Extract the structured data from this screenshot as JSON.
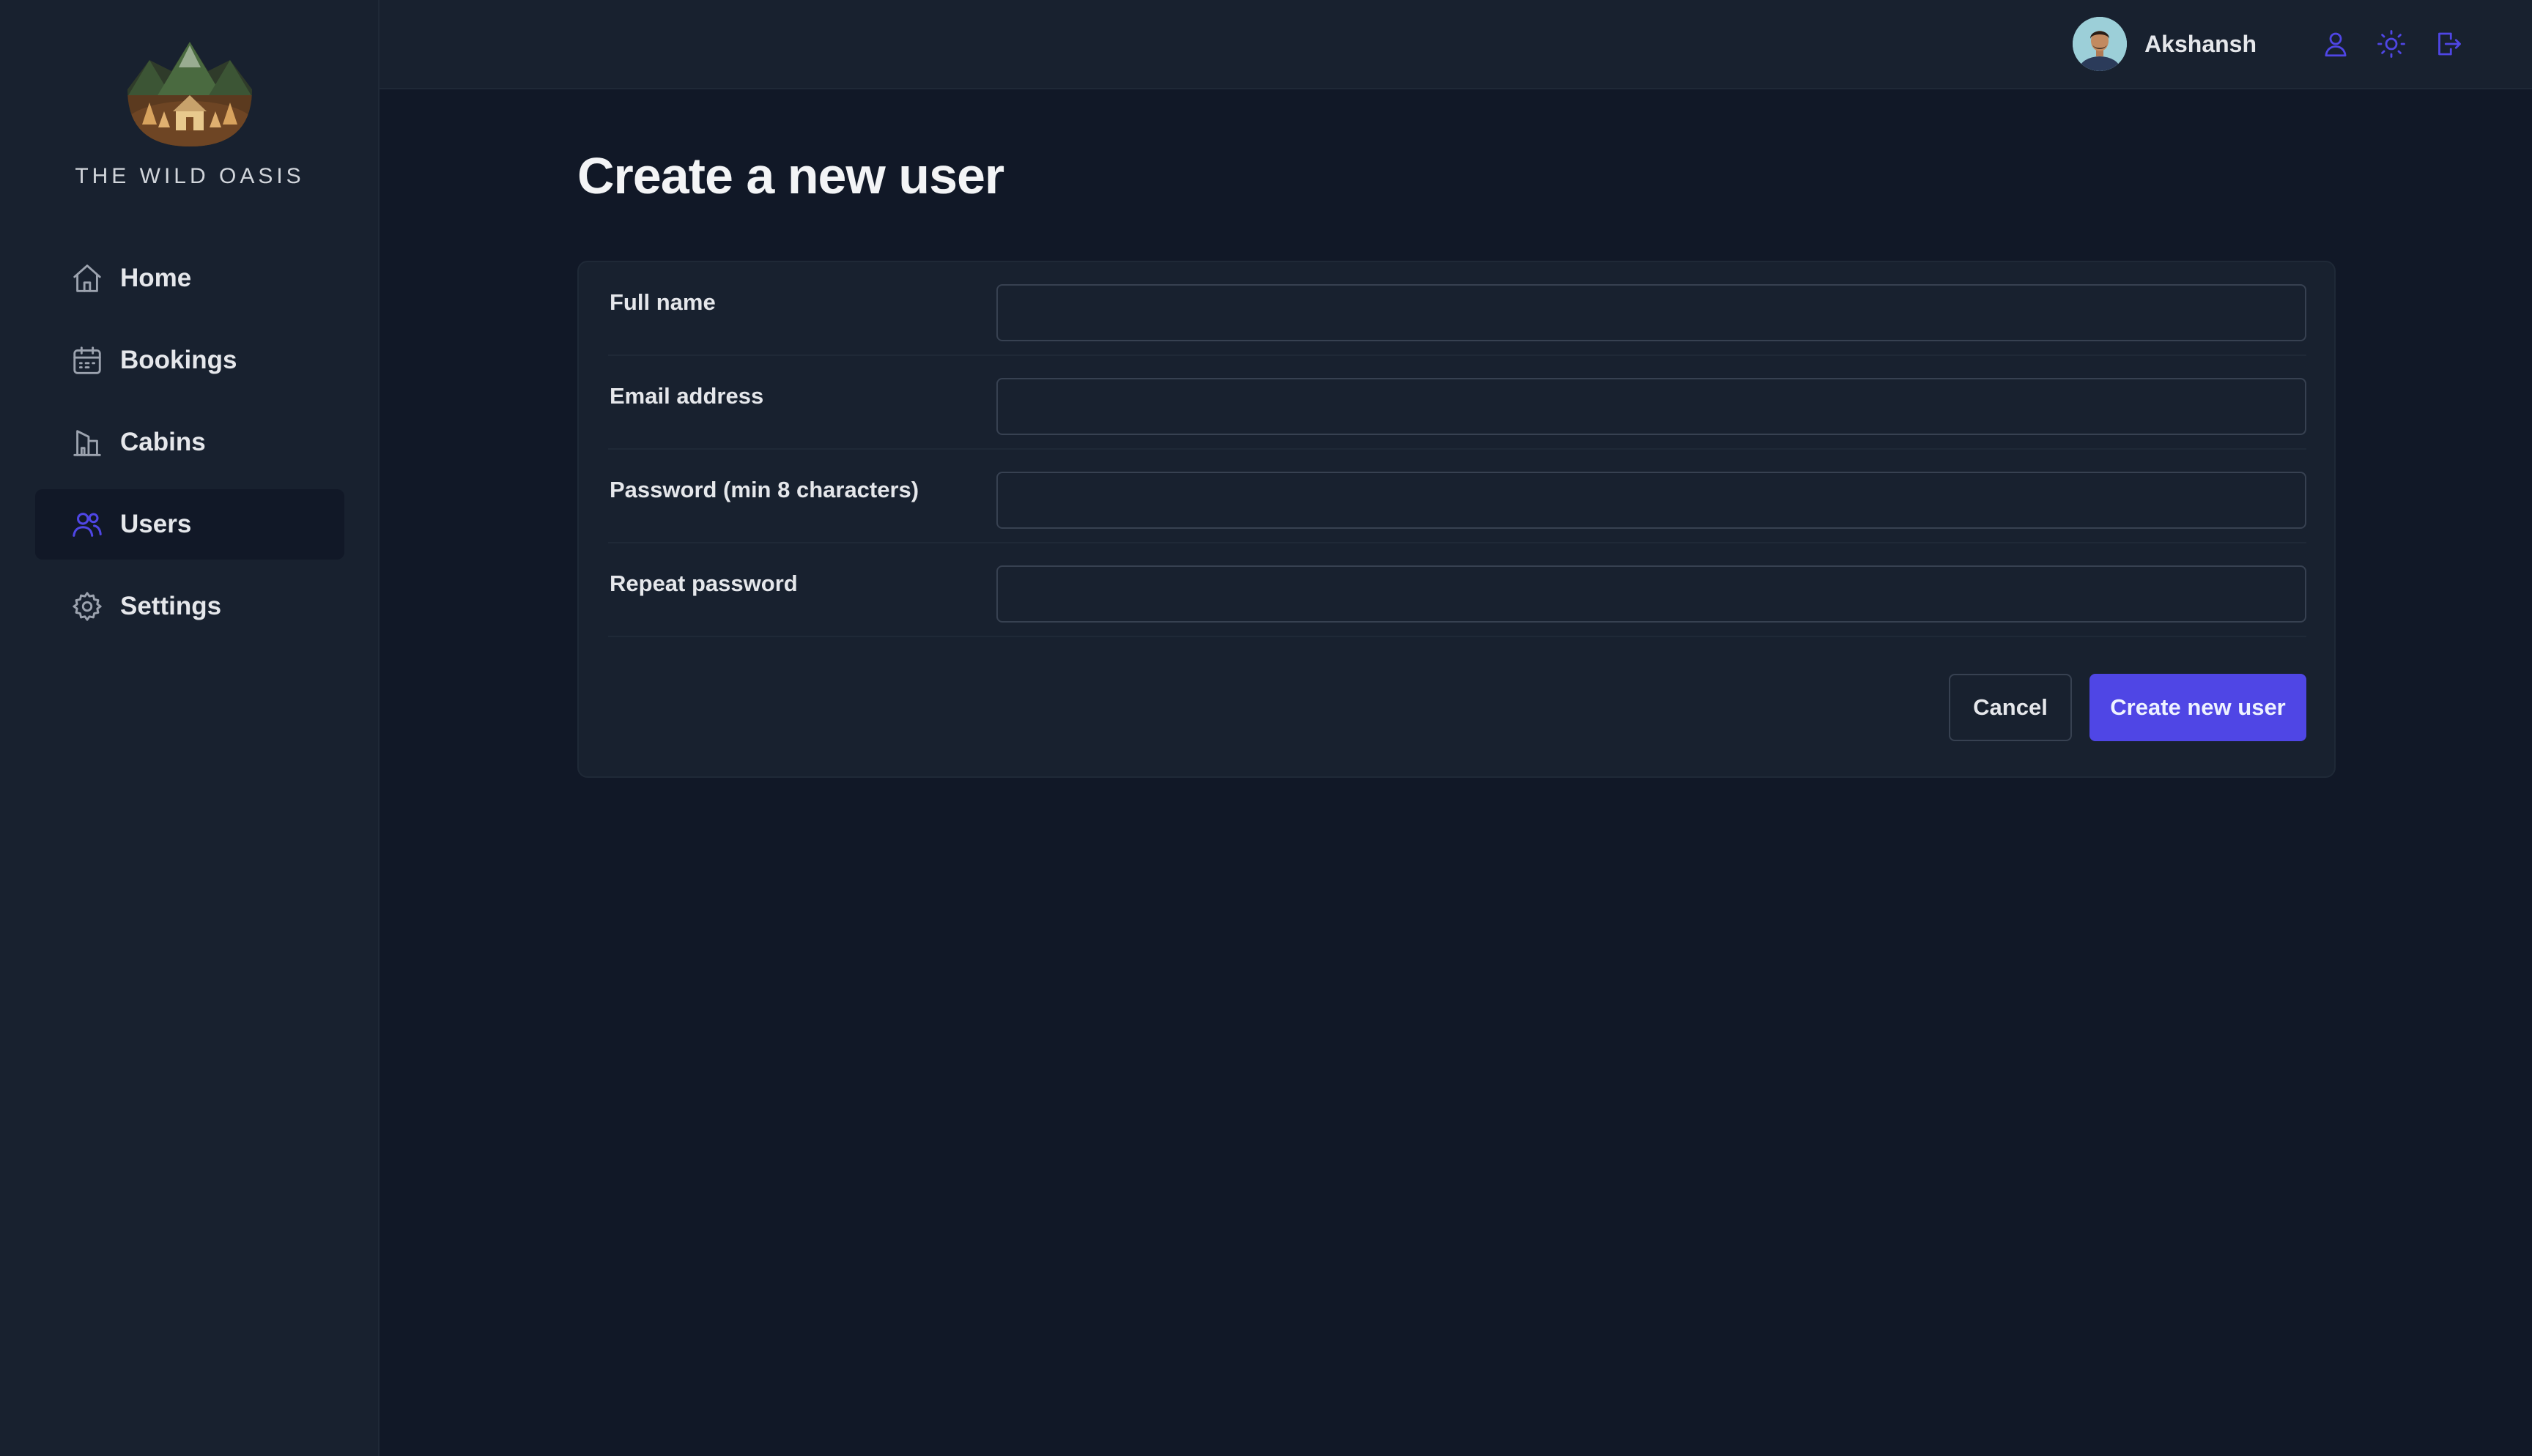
{
  "brand": {
    "name": "THE WILD OASIS",
    "logo_icon": "mountain-cabin-logo"
  },
  "sidebar": {
    "items": [
      {
        "label": "Home",
        "icon": "home-icon",
        "active": false
      },
      {
        "label": "Bookings",
        "icon": "calendar-icon",
        "active": false
      },
      {
        "label": "Cabins",
        "icon": "cabin-icon",
        "active": false
      },
      {
        "label": "Users",
        "icon": "users-icon",
        "active": true
      },
      {
        "label": "Settings",
        "icon": "gear-icon",
        "active": false
      }
    ]
  },
  "header": {
    "user_name": "Akshansh",
    "buttons": [
      {
        "icon": "user-icon"
      },
      {
        "icon": "sun-icon"
      },
      {
        "icon": "logout-icon"
      }
    ]
  },
  "main": {
    "title": "Create a new user",
    "form": {
      "fields": [
        {
          "label": "Full name",
          "value": ""
        },
        {
          "label": "Email address",
          "value": ""
        },
        {
          "label": "Password (min 8 characters)",
          "value": ""
        },
        {
          "label": "Repeat password",
          "value": ""
        }
      ],
      "cancel_label": "Cancel",
      "submit_label": "Create new user"
    }
  },
  "colors": {
    "accent": "#4f46e5",
    "background": "#111827",
    "panel": "#18212f",
    "border": "#374151",
    "text": "#e5e7eb"
  }
}
